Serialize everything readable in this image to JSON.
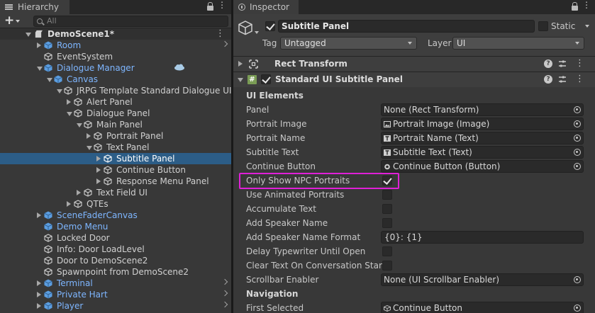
{
  "hierarchy": {
    "tab_title": "Hierarchy",
    "add_label": "+",
    "search_placeholder": "All",
    "items": [
      {
        "label": "DemoScene1*",
        "kind": "scene"
      },
      {
        "label": "Room",
        "kind": "prefab"
      },
      {
        "label": "EventSystem",
        "kind": "object"
      },
      {
        "label": "Dialogue Manager",
        "kind": "prefab"
      },
      {
        "label": "Canvas",
        "kind": "prefab"
      },
      {
        "label": "JRPG Template Standard Dialogue UI",
        "kind": "object"
      },
      {
        "label": "Alert Panel",
        "kind": "object"
      },
      {
        "label": "Dialogue Panel",
        "kind": "object"
      },
      {
        "label": "Main Panel",
        "kind": "object"
      },
      {
        "label": "Portrait Panel",
        "kind": "object"
      },
      {
        "label": "Text Panel",
        "kind": "object"
      },
      {
        "label": "Subtitle Panel",
        "kind": "object",
        "selected": true
      },
      {
        "label": "Continue Button",
        "kind": "object"
      },
      {
        "label": "Response Menu Panel",
        "kind": "object"
      },
      {
        "label": "Text Field UI",
        "kind": "object"
      },
      {
        "label": "QTEs",
        "kind": "object"
      },
      {
        "label": "SceneFaderCanvas",
        "kind": "prefab"
      },
      {
        "label": "Demo Menu",
        "kind": "prefab"
      },
      {
        "label": "Locked Door",
        "kind": "object"
      },
      {
        "label": "Info: Door LoadLevel",
        "kind": "object"
      },
      {
        "label": "Door to DemoScene2",
        "kind": "object"
      },
      {
        "label": "Spawnpoint from DemoScene2",
        "kind": "object"
      },
      {
        "label": "Terminal",
        "kind": "prefab"
      },
      {
        "label": "Private Hart",
        "kind": "prefab"
      },
      {
        "label": "Player",
        "kind": "prefab"
      }
    ]
  },
  "inspector": {
    "tab_title": "Inspector",
    "object_name": "Subtitle Panel",
    "static_label": "Static",
    "tag_label": "Tag",
    "tag_value": "Untagged",
    "layer_label": "Layer",
    "layer_value": "UI",
    "components": {
      "rect_transform": "Rect Transform",
      "subtitle_panel": "Standard UI Subtitle Panel"
    },
    "properties": [
      {
        "label": "UI Elements",
        "type": "section"
      },
      {
        "label": "Panel",
        "type": "object",
        "value": "None (Rect Transform)",
        "glyph": ""
      },
      {
        "label": "Portrait Image",
        "type": "object",
        "value": "Portrait Image (Image)",
        "glyph": "image"
      },
      {
        "label": "Portrait Name",
        "type": "object",
        "value": "Portrait Name (Text)",
        "glyph": "text"
      },
      {
        "label": "Subtitle Text",
        "type": "object",
        "value": "Subtitle Text (Text)",
        "glyph": "text"
      },
      {
        "label": "Continue Button",
        "type": "object",
        "value": "Continue Button (Button)",
        "glyph": "button"
      },
      {
        "label": "Only Show NPC Portraits",
        "type": "bool",
        "checked": true
      },
      {
        "label": "Use Animated Portraits",
        "type": "bool",
        "checked": false
      },
      {
        "label": "Accumulate Text",
        "type": "bool",
        "checked": false
      },
      {
        "label": "Add Speaker Name",
        "type": "bool",
        "checked": false
      },
      {
        "label": "Add Speaker Name Format",
        "type": "text",
        "value": "{0}: {1}"
      },
      {
        "label": "Delay Typewriter Until Open",
        "type": "bool",
        "checked": false
      },
      {
        "label": "Clear Text On Conversation Start",
        "type": "bool",
        "checked": false
      },
      {
        "label": "Scrollbar Enabler",
        "type": "object",
        "value": "None (UI Scrollbar Enabler)",
        "glyph": ""
      },
      {
        "label": "Navigation",
        "type": "section"
      },
      {
        "label": "First Selected",
        "type": "object",
        "value": "Continue Button",
        "glyph": "cube"
      }
    ]
  },
  "colors": {
    "selection": "#2c5d87",
    "prefab_text": "#7eb6ff",
    "highlight_box": "#e020d8"
  }
}
